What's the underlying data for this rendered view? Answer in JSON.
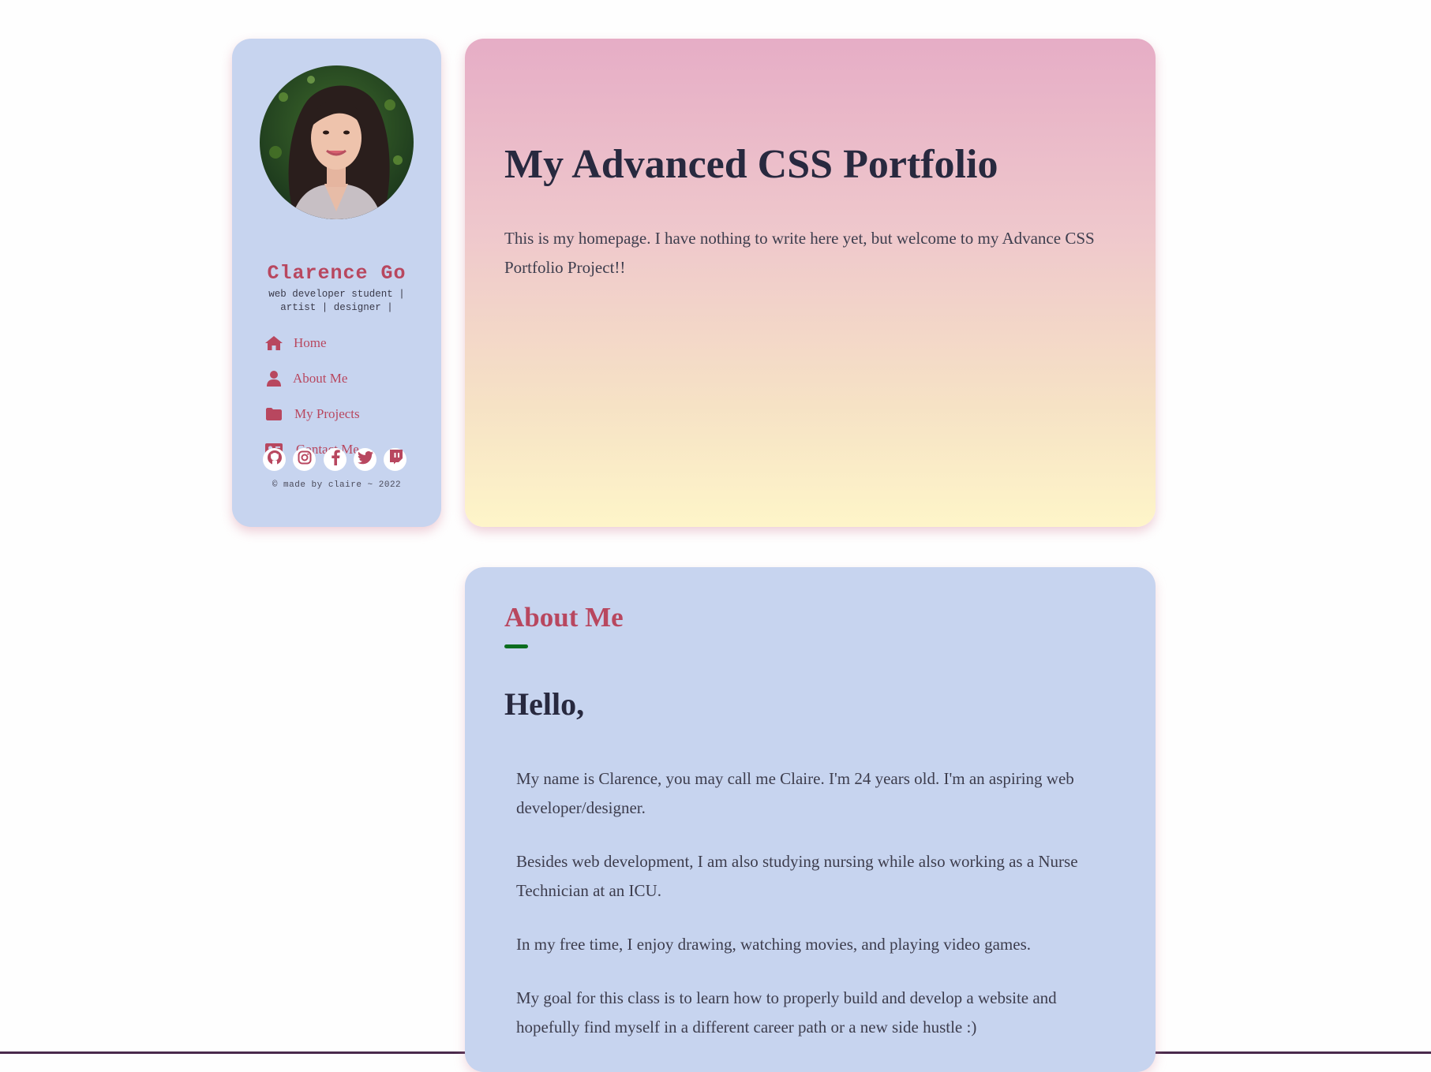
{
  "sidebar": {
    "name": "Clarence Go",
    "tagline": "web developer student | artist | designer |",
    "nav": [
      {
        "label": "Home",
        "icon": "home-icon"
      },
      {
        "label": "About Me",
        "icon": "user-icon"
      },
      {
        "label": "My Projects",
        "icon": "folder-icon"
      },
      {
        "label": "Contact Me",
        "icon": "id-card-icon"
      }
    ],
    "socials": [
      "github-icon",
      "instagram-icon",
      "facebook-icon",
      "twitter-icon",
      "twitch-icon"
    ],
    "copyright": "© made by claire ~ 2022"
  },
  "hero": {
    "title": "My Advanced CSS Portfolio",
    "text": "This is my homepage. I have nothing to write here yet, but welcome to my Advance CSS Portfolio Project!!"
  },
  "about": {
    "title": "About Me",
    "greeting": "Hello,",
    "paragraphs": [
      "My name is Clarence, you may call me Claire. I'm 24 years old. I'm an aspiring web developer/designer.",
      "Besides web development, I am also studying nursing while also working as a Nurse Technician at an ICU.",
      "In my free time, I enjoy drawing, watching movies, and playing video games.",
      "My goal for this class is to learn how to properly build and develop a website and hopefully find myself in a different career path or a new side hustle :)"
    ]
  },
  "colors": {
    "accent": "#b8475f",
    "card_blue": "#c7d4ef",
    "underline": "#0c6d1f",
    "heading": "#28293f"
  }
}
